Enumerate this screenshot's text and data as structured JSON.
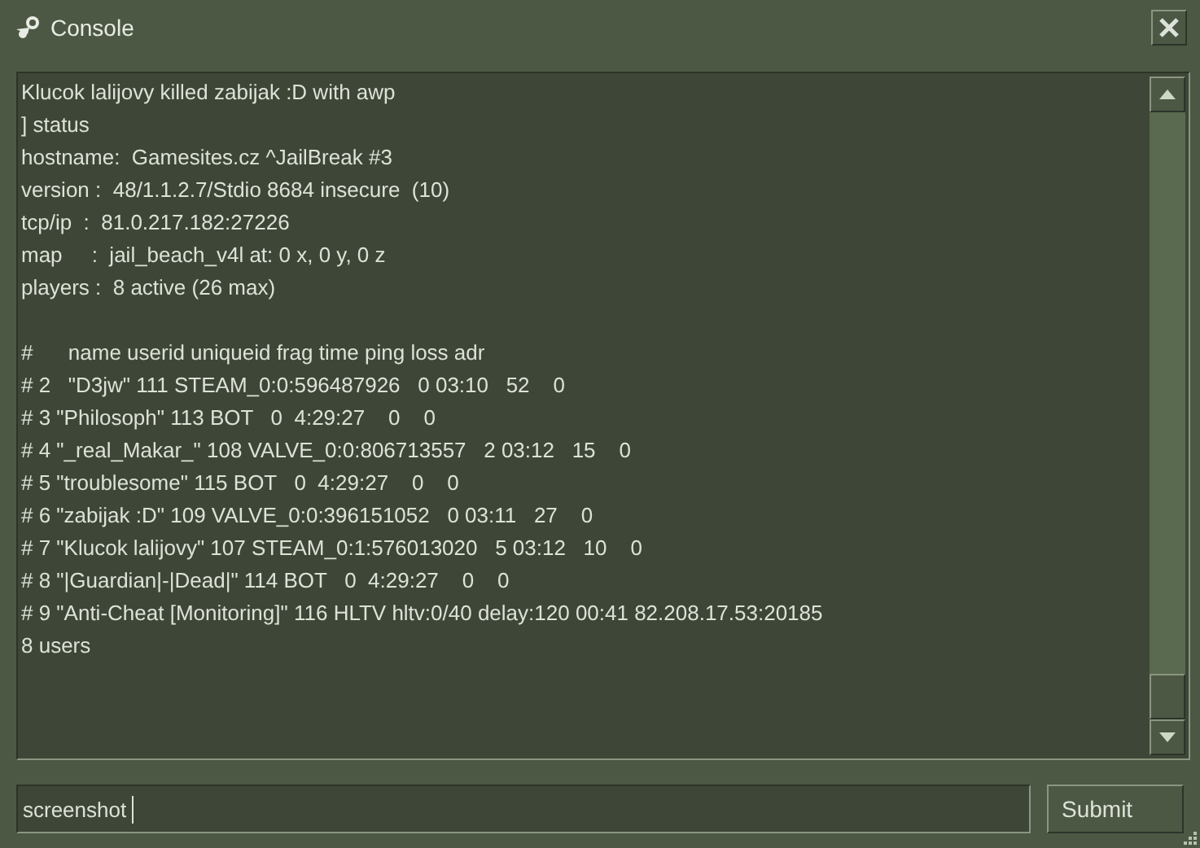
{
  "window": {
    "title": "Console"
  },
  "console_blocks": [
    [
      "Klucok lalijovy killed zabijak :D with awp",
      "] status",
      "hostname:  Gamesites.cz ^JailBreak #3",
      "version :  48/1.1.2.7/Stdio 8684 insecure  (10)",
      "tcp/ip  :  81.0.217.182:27226",
      "map     :  jail_beach_v4l at: 0 x, 0 y, 0 z",
      "players :  8 active (26 max)"
    ],
    [
      "#      name userid uniqueid frag time ping loss adr",
      "# 2   \"D3jw\" 111 STEAM_0:0:596487926   0 03:10   52    0",
      "# 3 \"Philosoph\" 113 BOT   0  4:29:27    0    0",
      "# 4 \"_real_Makar_\" 108 VALVE_0:0:806713557   2 03:12   15    0",
      "# 5 \"troublesome\" 115 BOT   0  4:29:27    0    0",
      "# 6 \"zabijak :D\" 109 VALVE_0:0:396151052   0 03:11   27    0",
      "# 7 \"Klucok lalijovy\" 107 STEAM_0:1:576013020   5 03:12   10    0",
      "# 8 \"|Guardian|-|Dead|\" 114 BOT   0  4:29:27    0    0",
      "# 9 \"Anti-Cheat [Monitoring]\" 116 HLTV hltv:0/40 delay:120 00:41 82.208.17.53:20185",
      "8 users"
    ]
  ],
  "command_input": {
    "value": "screenshot "
  },
  "submit_button": "Submit"
}
